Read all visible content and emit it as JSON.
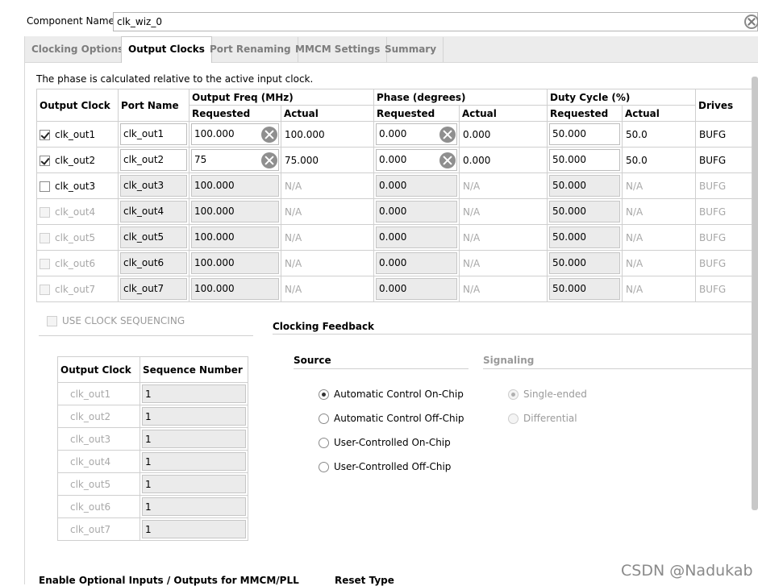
{
  "component": {
    "label": "Component Name",
    "value": "clk_wiz_0"
  },
  "tabs": [
    {
      "label": "Clocking Options",
      "active": false
    },
    {
      "label": "Output Clocks",
      "active": true
    },
    {
      "label": "Port Renaming",
      "active": false
    },
    {
      "label": "MMCM Settings",
      "active": false
    },
    {
      "label": "Summary",
      "active": false
    }
  ],
  "phase_note": "The phase is calculated relative to the active input clock.",
  "table": {
    "headers": {
      "output_clock": "Output Clock",
      "port_name": "Port Name",
      "freq": "Output Freq (MHz)",
      "phase": "Phase (degrees)",
      "duty": "Duty Cycle (%)",
      "drives": "Drives",
      "requested": "Requested",
      "actual": "Actual"
    },
    "rows": [
      {
        "clock": "clk_out1",
        "port": "clk_out1",
        "freq_req": "100.000",
        "freq_act": "100.000",
        "phase_req": "0.000",
        "phase_act": "0.000",
        "duty_req": "50.000",
        "duty_act": "50.0",
        "drives": "BUFG"
      },
      {
        "clock": "clk_out2",
        "port": "clk_out2",
        "freq_req": "75",
        "freq_act": "75.000",
        "phase_req": "0.000",
        "phase_act": "0.000",
        "duty_req": "50.000",
        "duty_act": "50.0",
        "drives": "BUFG"
      },
      {
        "clock": "clk_out3",
        "port": "clk_out3",
        "freq_req": "100.000",
        "freq_act": "N/A",
        "phase_req": "0.000",
        "phase_act": "N/A",
        "duty_req": "50.000",
        "duty_act": "N/A",
        "drives": "BUFG"
      },
      {
        "clock": "clk_out4",
        "port": "clk_out4",
        "freq_req": "100.000",
        "freq_act": "N/A",
        "phase_req": "0.000",
        "phase_act": "N/A",
        "duty_req": "50.000",
        "duty_act": "N/A",
        "drives": "BUFG"
      },
      {
        "clock": "clk_out5",
        "port": "clk_out5",
        "freq_req": "100.000",
        "freq_act": "N/A",
        "phase_req": "0.000",
        "phase_act": "N/A",
        "duty_req": "50.000",
        "duty_act": "N/A",
        "drives": "BUFG"
      },
      {
        "clock": "clk_out6",
        "port": "clk_out6",
        "freq_req": "100.000",
        "freq_act": "N/A",
        "phase_req": "0.000",
        "phase_act": "N/A",
        "duty_req": "50.000",
        "duty_act": "N/A",
        "drives": "BUFG"
      },
      {
        "clock": "clk_out7",
        "port": "clk_out7",
        "freq_req": "100.000",
        "freq_act": "N/A",
        "phase_req": "0.000",
        "phase_act": "N/A",
        "duty_req": "50.000",
        "duty_act": "N/A",
        "drives": "BUFG"
      }
    ]
  },
  "sequencing": {
    "checkbox_label": "USE CLOCK SEQUENCING",
    "headers": {
      "output_clock": "Output Clock",
      "sequence": "Sequence Number"
    },
    "rows": [
      {
        "clock": "clk_out1",
        "seq": "1"
      },
      {
        "clock": "clk_out2",
        "seq": "1"
      },
      {
        "clock": "clk_out3",
        "seq": "1"
      },
      {
        "clock": "clk_out4",
        "seq": "1"
      },
      {
        "clock": "clk_out5",
        "seq": "1"
      },
      {
        "clock": "clk_out6",
        "seq": "1"
      },
      {
        "clock": "clk_out7",
        "seq": "1"
      }
    ]
  },
  "feedback": {
    "title": "Clocking Feedback",
    "source_title": "Source",
    "signaling_title": "Signaling",
    "source_options": [
      "Automatic Control On-Chip",
      "Automatic Control Off-Chip",
      "User-Controlled On-Chip",
      "User-Controlled Off-Chip"
    ],
    "signaling_options": [
      "Single-ended",
      "Differential"
    ]
  },
  "bottom": {
    "left_title": "Enable Optional Inputs / Outputs for MMCM/PLL",
    "right_title": "Reset Type"
  },
  "watermark": "CSDN @Nadukab"
}
